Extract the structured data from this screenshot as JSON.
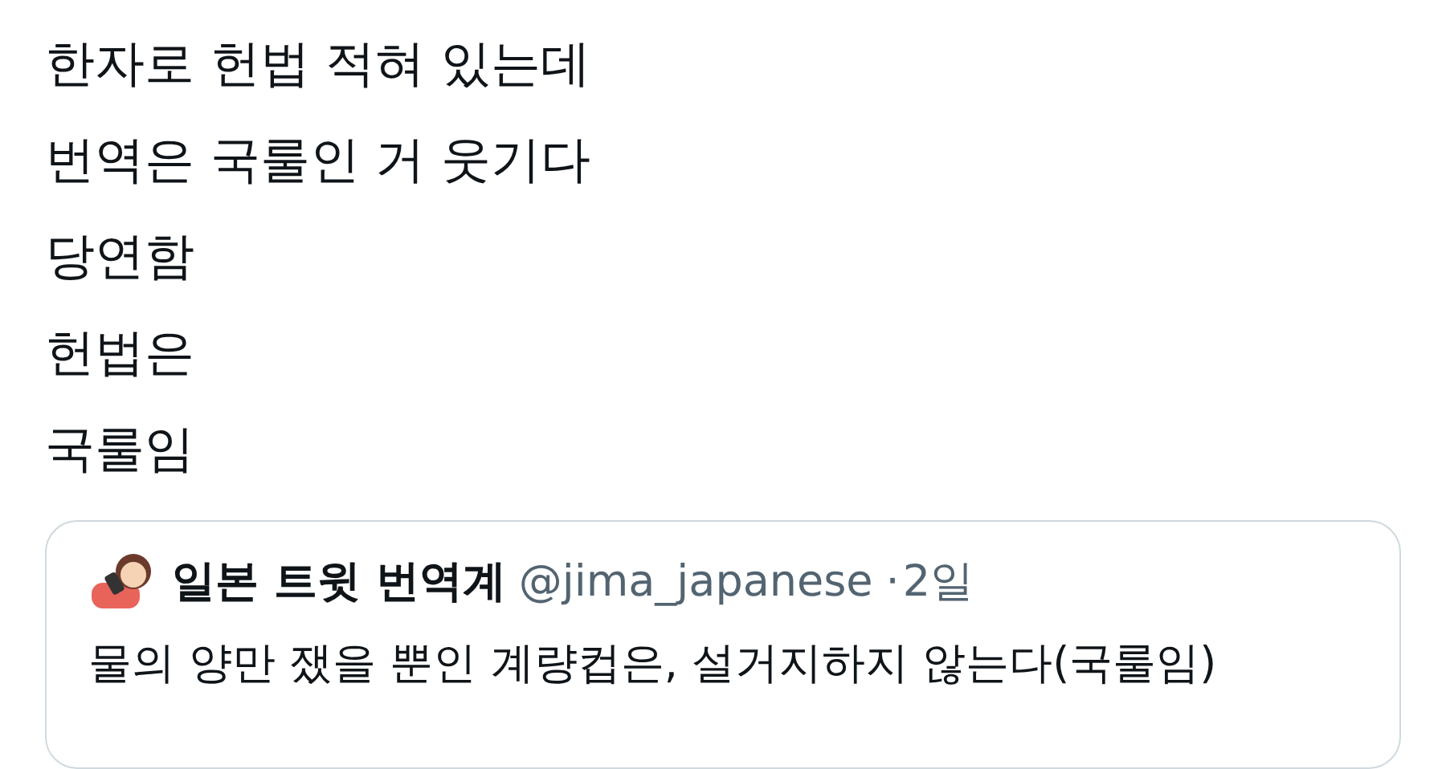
{
  "post": {
    "lines": [
      "한자로 헌법 적혀 있는데",
      "번역은 국룰인 거 웃기다",
      "당연함",
      "헌법은",
      "국룰임"
    ]
  },
  "quoted_post": {
    "author_name": "일본 트윗 번역계",
    "handle": "@jima_japanese",
    "separator": "·",
    "time": "2일",
    "text": "물의 양만 쟀을 뿐인 계량컵은, 설거지하지 않는다(국룰임)"
  }
}
